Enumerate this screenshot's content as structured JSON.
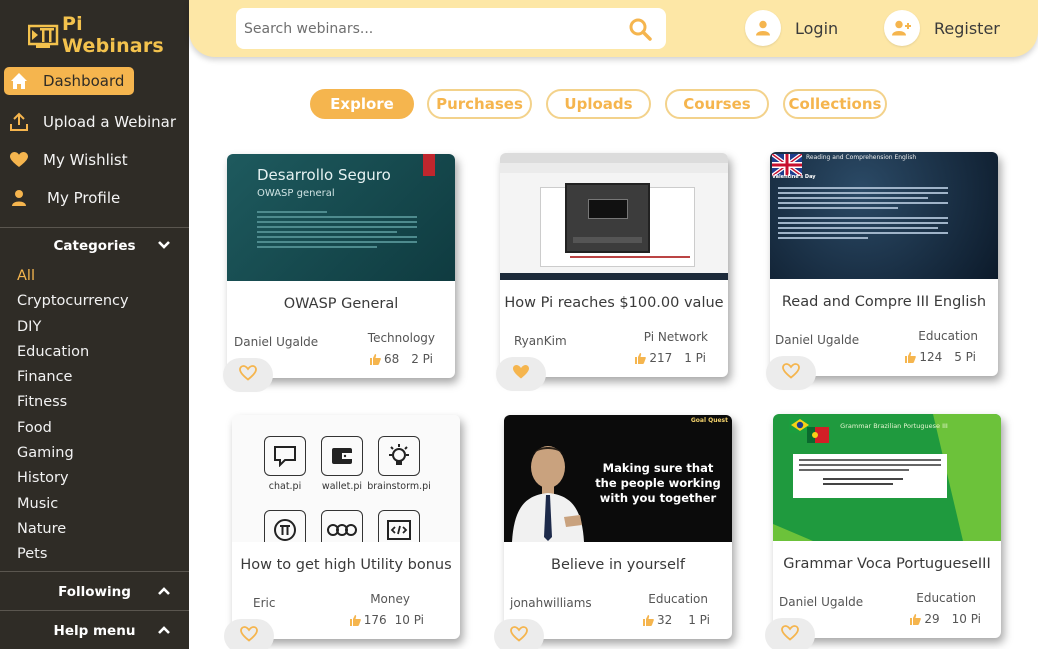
{
  "brand": {
    "name": "Pi Webinars"
  },
  "nav": [
    {
      "label": "Dashboard",
      "icon": "home-icon"
    },
    {
      "label": "Upload a Webinar",
      "icon": "upload-icon"
    },
    {
      "label": "My Wishlist",
      "icon": "heart-icon"
    },
    {
      "label": "My Profile",
      "icon": "user-icon"
    }
  ],
  "categories": {
    "title": "Categories",
    "items": [
      "All",
      "Cryptocurrency",
      "DIY",
      "Education",
      "Finance",
      "Fitness",
      "Food",
      "Gaming",
      "History",
      "Music",
      "Nature",
      "Pets"
    ]
  },
  "following": {
    "title": "Following"
  },
  "help": {
    "title": "Help menu"
  },
  "search": {
    "placeholder": "Search webinars..."
  },
  "auth": {
    "login": "Login",
    "register": "Register"
  },
  "tabs": [
    "Explore",
    "Purchases",
    "Uploads",
    "Courses",
    "Collections"
  ],
  "cards": [
    {
      "title": "OWASP General",
      "author": "Daniel Ugalde",
      "category": "Technology",
      "likes": "68",
      "price": "2 Pi",
      "thumb": {
        "heading": "Desarrollo Seguro",
        "sub": "OWASP general"
      }
    },
    {
      "title": "How Pi reaches $100.00 value",
      "author": "RyanKim",
      "category": "Pi Network",
      "likes": "217",
      "price": "1 Pi"
    },
    {
      "title": "Read and Compre III English",
      "author": "Daniel Ugalde",
      "category": "Education",
      "likes": "124",
      "price": "5 Pi",
      "thumb": {
        "heading": "Reading and Comprehension English",
        "sub": "Valentine's Day"
      }
    },
    {
      "title": "How to get high Utility bonus",
      "author": "Eric",
      "category": "Money",
      "likes": "176",
      "price": "10 Pi",
      "thumb": {
        "apps": [
          "chat.pi",
          "wallet.pi",
          "brainstorm.pi"
        ]
      }
    },
    {
      "title": "Believe in yourself",
      "author": "jonahwilliams",
      "category": "Education",
      "likes": "32",
      "price": "1 Pi",
      "thumb": {
        "quote": "Making sure that the people working with you together",
        "tag": "Goal Quest"
      }
    },
    {
      "title": "Grammar Voca PortugueseIII",
      "author": "Daniel Ugalde",
      "category": "Education",
      "likes": "29",
      "price": "10 Pi",
      "thumb": {
        "heading": "Grammar Brazilian Portuguese III"
      }
    }
  ],
  "colors": {
    "accent": "#f5b54e",
    "sidebar": "#2f2c26",
    "topbar": "#fde7a6"
  }
}
